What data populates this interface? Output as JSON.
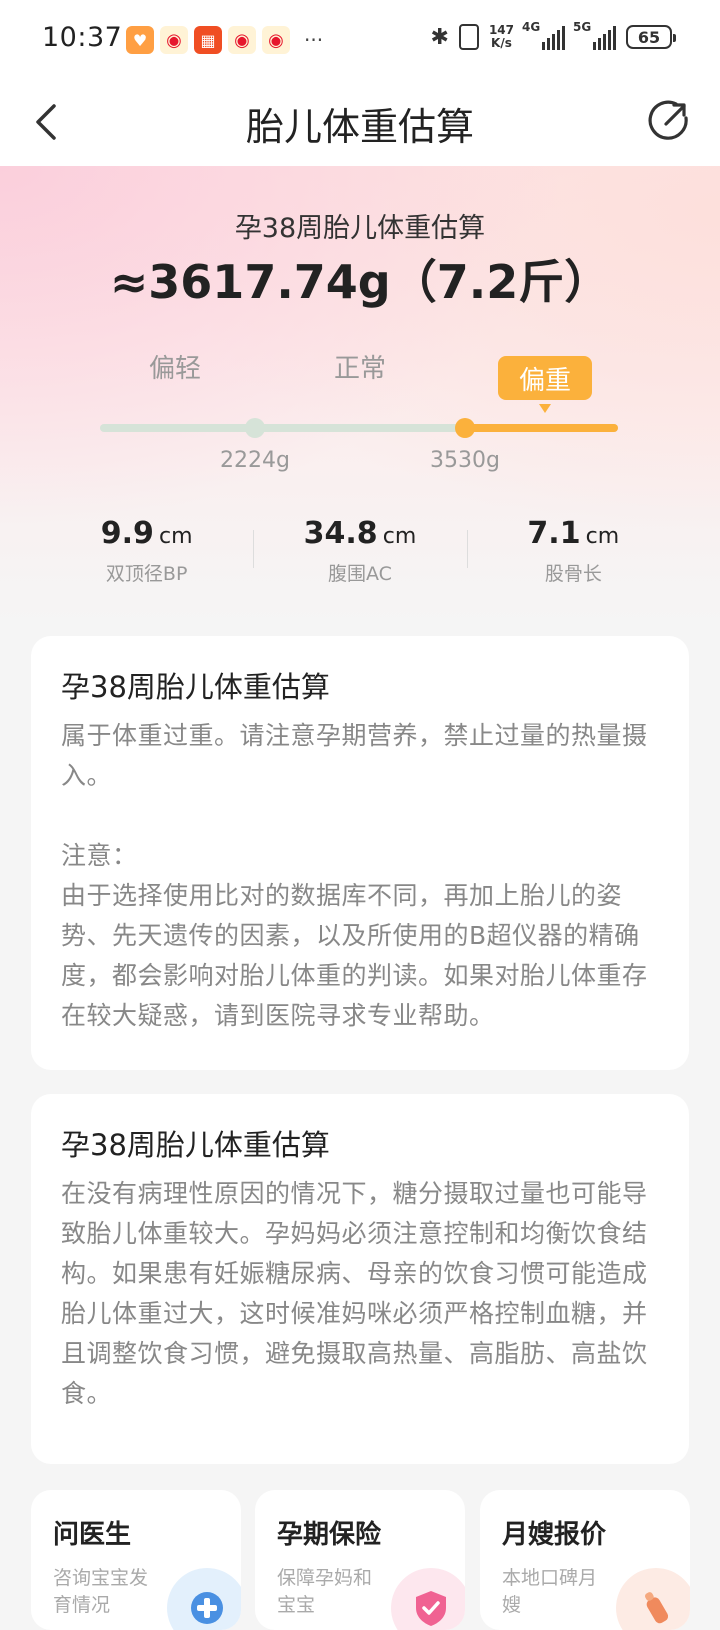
{
  "status_bar": {
    "time": "10:37",
    "net_speed_top": "147",
    "net_speed_bottom": "K/s",
    "sig1": "4G",
    "sig2": "5G",
    "battery": "65"
  },
  "header": {
    "title": "胎儿体重估算"
  },
  "hero": {
    "subtitle": "孕38周胎儿体重估算",
    "value": "≈3617.74g（7.2斤）",
    "levels": {
      "light": "偏轻",
      "normal": "正常",
      "heavy": "偏重"
    },
    "thresholds": {
      "low": "2224g",
      "high": "3530g"
    },
    "metrics": [
      {
        "value": "9.9",
        "unit": "cm",
        "label": "双顶径BP"
      },
      {
        "value": "34.8",
        "unit": "cm",
        "label": "腹围AC"
      },
      {
        "value": "7.1",
        "unit": "cm",
        "label": "股骨长"
      }
    ]
  },
  "card1": {
    "title": "孕38周胎儿体重估算",
    "text": "属于体重过重。请注意孕期营养，禁止过量的热量摄入。",
    "note_label": "注意：",
    "note_text": "由于选择使用比对的数据库不同，再加上胎儿的姿势、先天遗传的因素，以及所使用的B超仪器的精确度，都会影响对胎儿体重的判读。如果对胎儿体重存在较大疑惑，请到医院寻求专业帮助。"
  },
  "card2": {
    "title": "孕38周胎儿体重估算",
    "text": "在没有病理性原因的情况下，糖分摄取过量也可能导致胎儿体重较大。孕妈妈必须注意控制和均衡饮食结构。如果患有妊娠糖尿病、母亲的饮食习惯可能造成胎儿体重过大，这时候准妈咪必须严格控制血糖，并且调整饮食习惯，避免摄取高热量、高脂肪、高盐饮食。"
  },
  "services": [
    {
      "title": "问医生",
      "desc": "咨询宝宝发育情况",
      "icon": "doctor-plus-icon"
    },
    {
      "title": "孕期保险",
      "desc": "保障孕妈和宝宝",
      "icon": "shield-check-icon"
    },
    {
      "title": "月嫂报价",
      "desc": "本地口碑月嫂",
      "icon": "bottle-icon"
    }
  ],
  "colors": {
    "accent": "#fbb13c",
    "track": "#d6e3d8"
  }
}
